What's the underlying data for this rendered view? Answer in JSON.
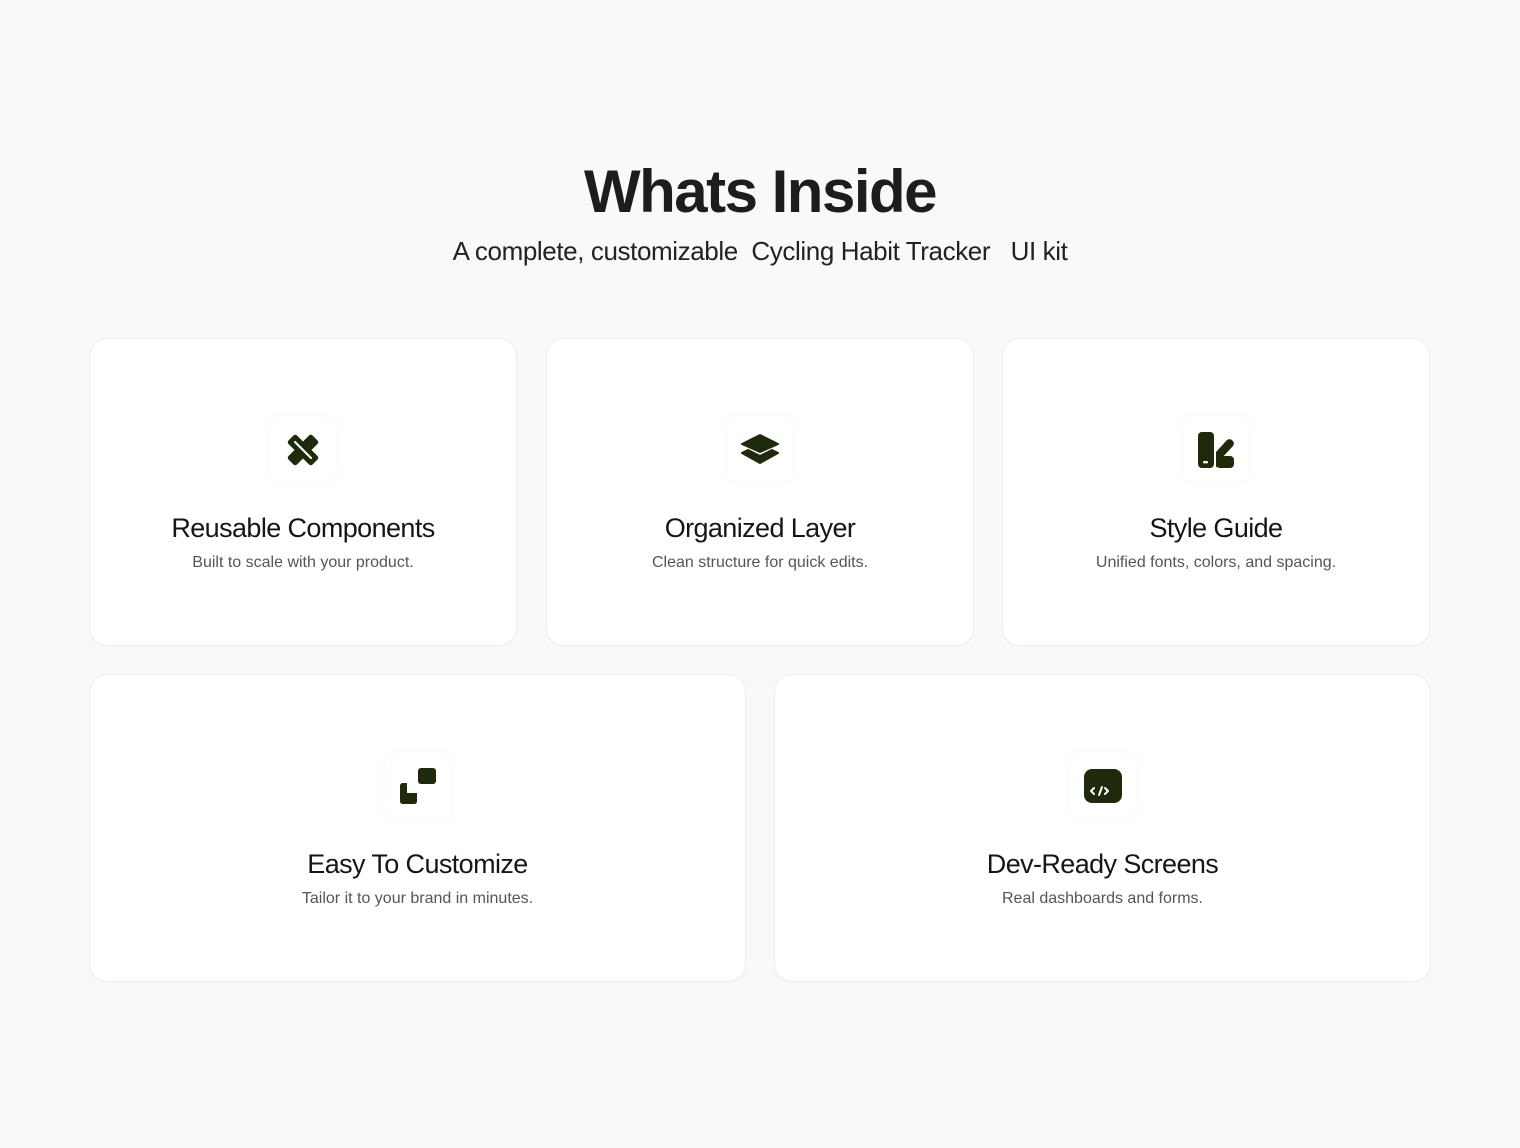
{
  "header": {
    "title": "Whats Inside",
    "subtitle": "A complete, customizable  Cycling Habit Tracker   UI kit"
  },
  "theme": {
    "page_background": "#f9f9fa",
    "card_background": "#ffffff",
    "icon_color": "#1e2a0b"
  },
  "features": [
    {
      "icon": "pencil-ruler-icon",
      "title": "Reusable Components",
      "description": "Built to scale with your product."
    },
    {
      "icon": "layers-icon",
      "title": "Organized Layer",
      "description": "Clean structure for quick edits."
    },
    {
      "icon": "color-swatch-icon",
      "title": "Style Guide",
      "description": "Unified fonts, colors, and spacing."
    },
    {
      "icon": "resize-squares-icon",
      "title": "Easy To Customize",
      "description": "Tailor it to your brand in minutes."
    },
    {
      "icon": "code-screen-icon",
      "title": "Dev-Ready Screens",
      "description": "Real dashboards and forms."
    }
  ]
}
